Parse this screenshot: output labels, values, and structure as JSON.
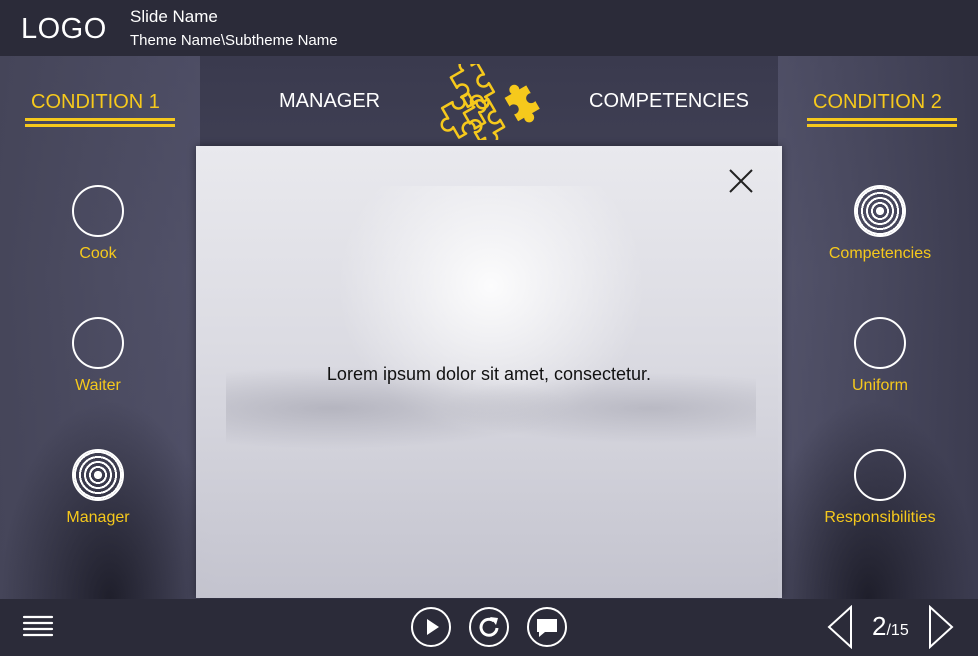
{
  "header": {
    "logo": "LOGO",
    "slide_name": "Slide Name",
    "theme_name": "Theme Name\\Subtheme Name"
  },
  "nav": {
    "condition1": "CONDITION 1",
    "tab_manager": "MANAGER",
    "tab_competencies": "COMPETENCIES",
    "condition2": "CONDITION 2",
    "center_icon": "puzzle-icon"
  },
  "left_buttons": [
    {
      "label": "Cook",
      "state": "empty"
    },
    {
      "label": "Waiter",
      "state": "empty"
    },
    {
      "label": "Manager",
      "state": "active"
    }
  ],
  "right_buttons": [
    {
      "label": "Competencies",
      "state": "active"
    },
    {
      "label": "Uniform",
      "state": "empty"
    },
    {
      "label": "Responsibilities",
      "state": "empty"
    }
  ],
  "popup": {
    "text": "Lorem ipsum dolor sit amet, consectetur.",
    "close_icon": "close-icon"
  },
  "footer": {
    "menu_icon": "hamburger-icon",
    "play_icon": "play-icon",
    "replay_icon": "replay-icon",
    "chat_icon": "chat-icon",
    "current_page": "2",
    "total_pages": "/15"
  },
  "colors": {
    "accent": "#f6c91c",
    "bar": "#2b2b39"
  }
}
